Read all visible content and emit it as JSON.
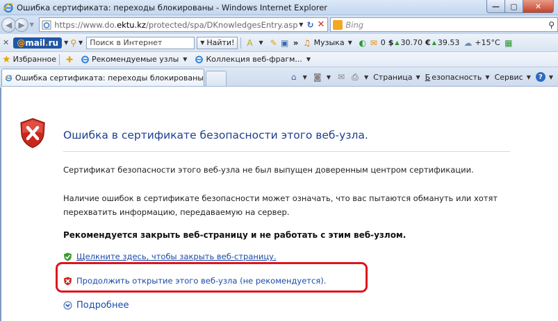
{
  "window": {
    "title": "Ошибка сертификата: переходы блокированы - Windows Internet Explorer",
    "buttons": {
      "minimize": "—",
      "maximize": "▢",
      "close": "✕"
    }
  },
  "address_bar": {
    "url_prefix": "https://www.do.",
    "url_domain": "ektu.kz",
    "url_suffix": "/protected/spa/DKnowledgesEntry.asp",
    "search_placeholder": "Bing"
  },
  "mailru_toolbar": {
    "logo_at": "@",
    "logo_mail": "mail",
    "logo_dot": ".",
    "logo_ru": "ru",
    "search_placeholder": "Поиск в Интернет",
    "find_button": "Найти!",
    "music": "Музыка",
    "mail_count": "0",
    "usd": "30.70",
    "eur": "39.53",
    "weather": "+15°C"
  },
  "favorites_bar": {
    "favorites_label": "Избранное",
    "items": [
      {
        "label": "Рекомендуемые узлы"
      },
      {
        "label": "Коллекция веб-фрагм..."
      }
    ]
  },
  "tabs": [
    {
      "label": "Ошибка сертификата: переходы блокированы"
    }
  ],
  "command_bar": {
    "page": "Страница",
    "safety_first": "Б",
    "safety_rest": "езопасность",
    "tools": "Сервис",
    "tools_underline": "и"
  },
  "content": {
    "title": "Ошибка в сертификате безопасности этого веб-узла.",
    "paragraph1": "Сертификат безопасности этого веб-узла не был выпущен доверенным центром сертификации.",
    "paragraph2": "Наличие ошибок в сертификате безопасности может означать, что вас пытаются обмануть или хотят перехватить информацию, передаваемую на сервер.",
    "recommendation": "Рекомендуется закрыть веб-страницу и не работать с этим веб-узлом.",
    "link_close": "Щелкните здесь, чтобы закрыть веб-страницу.",
    "link_continue": "Продолжить открытие этого веб-узла (не рекомендуется).",
    "more_info": "Подробнее"
  },
  "colors": {
    "link": "#1a4aa8",
    "title": "#1c3e8e",
    "highlight": "#e0121b",
    "shield_red": "#c8271d"
  },
  "icons": [
    "ie-icon",
    "back-icon",
    "forward-icon",
    "refresh-icon",
    "stop-icon",
    "bing-icon",
    "search-icon",
    "favorites-star-icon",
    "home-icon",
    "rss-icon",
    "mail-icon",
    "print-icon",
    "help-icon",
    "shield-error-icon",
    "green-check-icon",
    "red-x-icon",
    "expand-icon"
  ]
}
